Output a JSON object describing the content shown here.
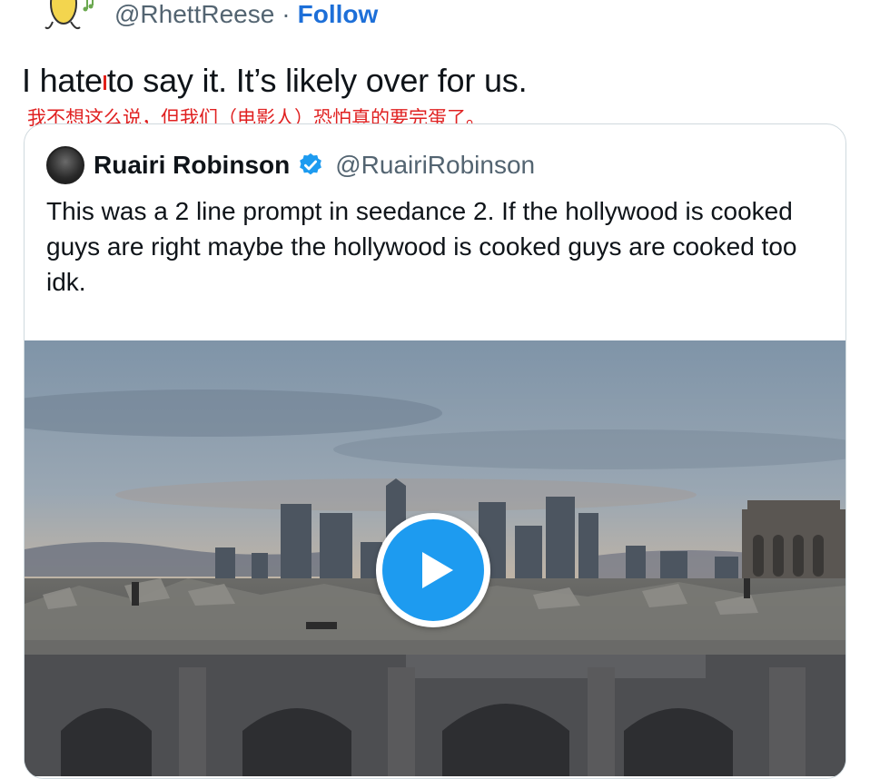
{
  "author": {
    "handle": "@RhettReese",
    "separator": "·",
    "follow_label": "Follow",
    "avatar_icon": "banana-cartoon-avatar-icon"
  },
  "tweet": {
    "text_part1": "I hate",
    "text_part2": "to say it. It’s likely over for us.",
    "translation": "我不想这么说，但我们（电影人）恐怕真的要完蛋了。"
  },
  "quote": {
    "name": "Ruairi Robinson",
    "handle": "@RuairiRobinson",
    "verified_icon": "verified-badge-icon",
    "body": "This was a 2 line prompt in seedance 2. If the hollywood is cooked guys are right maybe the hollywood is cooked guys are cooked too idk.",
    "media": {
      "type": "video",
      "play_icon": "play-icon",
      "description_colors": {
        "accent": "#1d9bf0"
      }
    }
  },
  "colors": {
    "link": "#1d6fd8",
    "translation": "#e02121",
    "muted": "#536471"
  }
}
